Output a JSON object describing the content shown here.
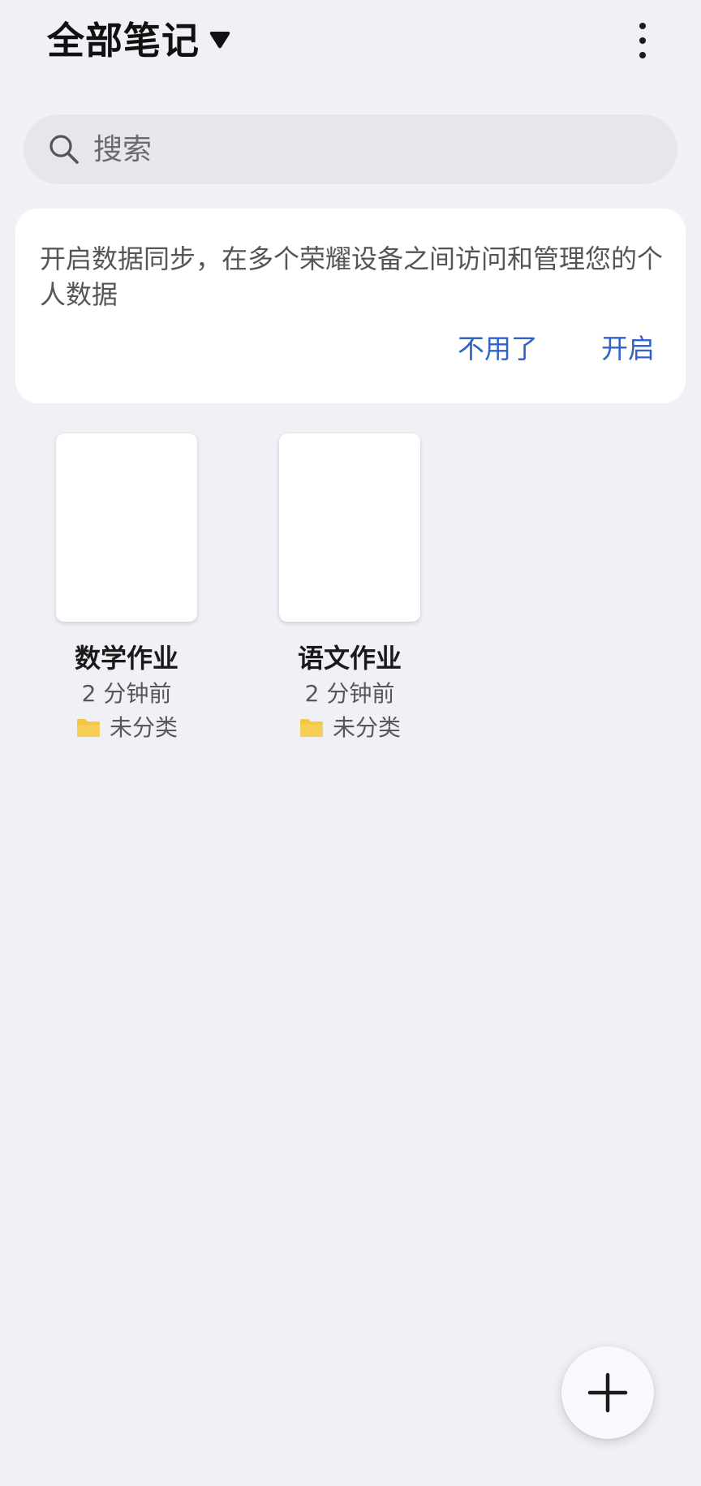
{
  "header": {
    "title": "全部笔记",
    "dropdown_icon": "caret-down-icon",
    "more_icon": "more-vertical-icon"
  },
  "search": {
    "placeholder": "搜索",
    "value": "",
    "icon": "search-icon"
  },
  "sync_card": {
    "message": "开启数据同步，在多个荣耀设备之间访问和管理您的个人数据",
    "dismiss_label": "不用了",
    "enable_label": "开启",
    "action_color": "#2f63c8"
  },
  "notes": [
    {
      "title": "数学作业",
      "time": "2 分钟前",
      "folder": "未分类",
      "folder_icon": "folder-icon"
    },
    {
      "title": "语文作业",
      "time": "2 分钟前",
      "folder": "未分类",
      "folder_icon": "folder-icon"
    }
  ],
  "fab": {
    "icon": "plus-icon"
  },
  "colors": {
    "background": "#f0f1f6",
    "card": "#ffffff",
    "accent": "#2f63c8",
    "folder": "#f5c544"
  }
}
